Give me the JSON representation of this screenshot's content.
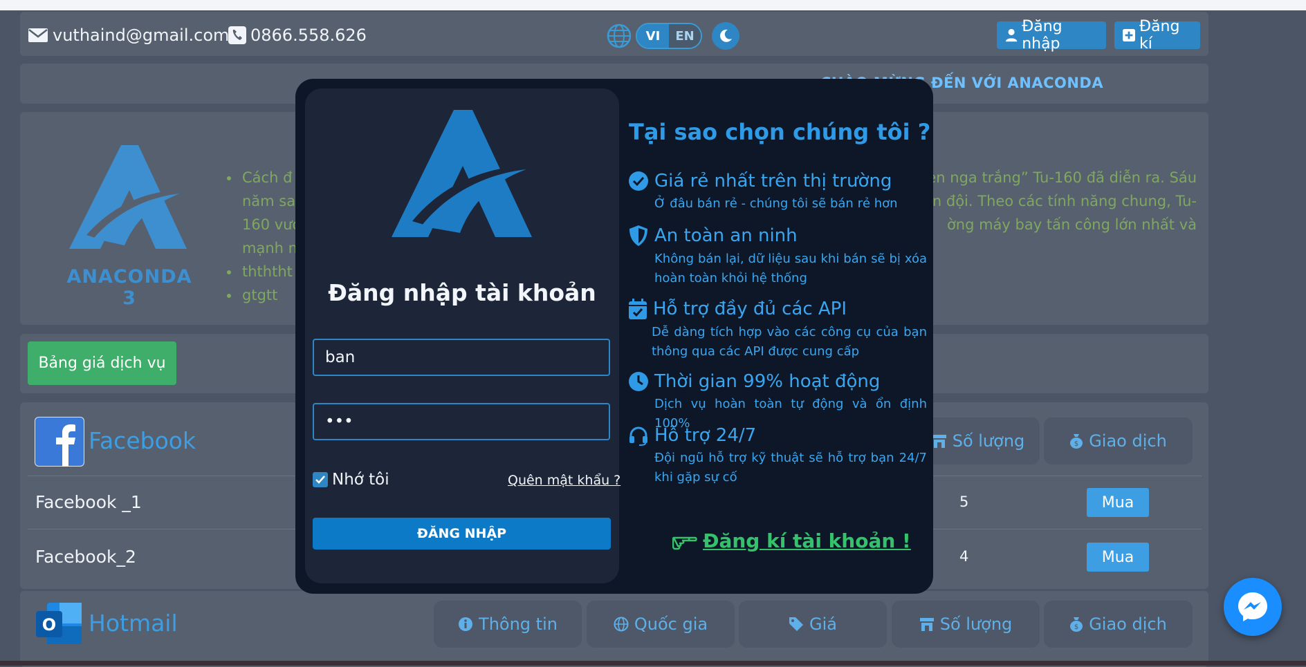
{
  "header": {
    "email": "vuthaind@gmail.com",
    "phone": "0866.558.626",
    "lang_vi": "VI",
    "lang_en": "EN",
    "login_label": "Đăng nhập",
    "register_label": "Đăng kí"
  },
  "welcome": {
    "text": "CHÀO MỪNG ĐẾN VỚI ANACONDA"
  },
  "intro": {
    "logo_text": "ANACONDA 3",
    "bullets": [
      "Cách đ",
      "năm sa",
      "160 vượ",
      "mạnh n",
      "thththt",
      "gtgtt"
    ],
    "right_lines": [
      "en nga trắng” Tu-160 đã diễn ra. Sáu",
      "n đội. Theo các tính năng chung, Tu-",
      "ờng máy bay tấn công lớn nhất và"
    ]
  },
  "pricing_button": "Bảng giá dịch vụ",
  "facebook": {
    "name": "Facebook",
    "col_qty": "Số lượng",
    "col_trade": "Giao dịch",
    "rows": [
      {
        "name": "Facebook _1",
        "qty": "5",
        "buy": "Mua"
      },
      {
        "name": "Facebook_2",
        "qty": "4",
        "buy": "Mua"
      }
    ]
  },
  "hotmail": {
    "name": "Hotmail",
    "cols": [
      "Thông tin",
      "Quốc gia",
      "Giá",
      "Số lượng",
      "Giao dịch"
    ]
  },
  "modal": {
    "title": "Đăng nhập tài khoản",
    "username": "ban",
    "password": "•••",
    "remember": "Nhớ tôi",
    "forgot": "Quên mật khẩu ?",
    "login_button": "ĐĂNG NHẬP",
    "why_title": "Tại sao chọn chúng tôi ?",
    "features": [
      {
        "icon": "check-circle-icon",
        "title": "Giá rẻ nhất trên thị trường",
        "desc": "Ở đâu bán rẻ - chúng tôi sẽ bán rẻ hơn"
      },
      {
        "icon": "shield-icon",
        "title": "An toàn an ninh",
        "desc": "Không bán lại, dữ liệu sau khi bán sẽ bị xóa hoàn toàn khỏi hệ thống"
      },
      {
        "icon": "calendar-check-icon",
        "title": "Hỗ trợ đầy đủ các API",
        "desc": "Dễ dàng tích hợp vào các công cụ của bạn thông qua các API được cung cấp"
      },
      {
        "icon": "clock-icon",
        "title": "Thời gian 99% hoạt động",
        "desc": "Dịch vụ hoàn toàn tự động và ổn định 100%"
      },
      {
        "icon": "headset-icon",
        "title": "Hỗ trợ 24/7",
        "desc": "Đội ngũ hỗ trợ kỹ thuật sẽ hỗ trợ bạn 24/7 khi gặp sự cố"
      }
    ],
    "register_link": "Đăng kí tài khoản !"
  },
  "colors": {
    "accent": "#2f86c4",
    "background": "#4b5566",
    "modal_bg": "#0e1728",
    "green": "#3fae6a"
  }
}
